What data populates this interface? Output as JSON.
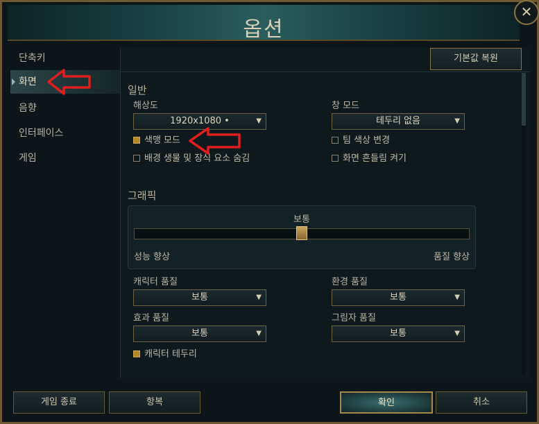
{
  "window": {
    "title": "옵션",
    "close_glyph": "✕"
  },
  "sidebar": {
    "items": [
      {
        "label": "단축키",
        "active": false
      },
      {
        "label": "화면",
        "active": true
      },
      {
        "label": "음향",
        "active": false
      },
      {
        "label": "인터페이스",
        "active": false
      },
      {
        "label": "게임",
        "active": false
      }
    ]
  },
  "toolbar": {
    "reset_label": "기본값 복원"
  },
  "general": {
    "title": "일반",
    "resolution": {
      "label": "해상도",
      "value": "1920x1080 •"
    },
    "window_mode": {
      "label": "창 모드",
      "value": "테두리 없음"
    },
    "checkboxes": {
      "colorblind": {
        "label": "색맹 모드",
        "checked": true
      },
      "team_color": {
        "label": "팀 색상 변경",
        "checked": false
      },
      "hide_eyecandy": {
        "label": "배경 생물 및 장식 요소 숨김",
        "checked": false
      },
      "screen_shake": {
        "label": "화면 흔들림 켜기",
        "checked": false
      }
    }
  },
  "graphics": {
    "title": "그래픽",
    "preset_label": "보통",
    "slider_min_label": "성능 향상",
    "slider_max_label": "품질 향상",
    "slider_value": 0.5,
    "character_quality": {
      "label": "캐릭터 품질",
      "value": "보통"
    },
    "environment_quality": {
      "label": "환경 품질",
      "value": "보통"
    },
    "effects_quality": {
      "label": "효과 품질",
      "value": "보통"
    },
    "shadow_quality": {
      "label": "그림자 품질",
      "value": "보통"
    },
    "character_inking": {
      "label": "캐릭터 테두리",
      "checked": true
    }
  },
  "footer": {
    "exit_label": "게임 종료",
    "surrender_label": "항복",
    "ok_label": "확인",
    "cancel_label": "취소"
  },
  "colors": {
    "accent_gold": "#b4882a",
    "annotation_red": "#e01e1e",
    "frame_gold": "#6e5a32"
  },
  "icons": {
    "dropdown_arrow": "▼",
    "annotation_arrow": "red-left-arrow"
  }
}
